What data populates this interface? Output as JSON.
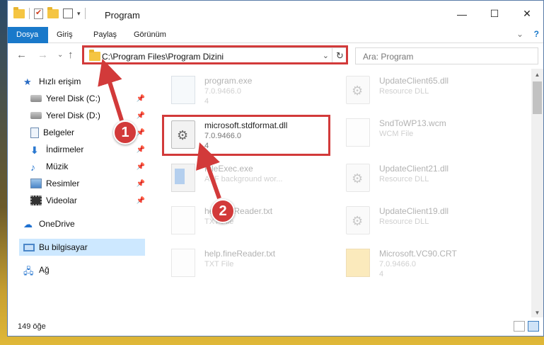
{
  "window": {
    "title": "Program",
    "controls": {
      "minimize": "—",
      "maximize": "☐",
      "close": "✕"
    }
  },
  "ribbon": {
    "tabs": [
      "Dosya",
      "Giriş",
      "Paylaş",
      "Görünüm"
    ],
    "active_tab": "Dosya",
    "expand": "⌄",
    "help": "?"
  },
  "address": {
    "back": "←",
    "forward": "→",
    "recent": "⌄",
    "up": "↑",
    "path": "C:\\Program Files\\Program Dizini",
    "dropdown": "⌄",
    "refresh": "↻"
  },
  "search": {
    "placeholder": "Ara: Program"
  },
  "sidebar": {
    "items": [
      {
        "label": "Hızlı erişim",
        "icon": "star-icon",
        "pinned": false
      },
      {
        "label": "Yerel Disk (C:)",
        "icon": "disk-icon",
        "pinned": true
      },
      {
        "label": "Yerel Disk (D:)",
        "icon": "disk-icon",
        "pinned": true
      },
      {
        "label": "Belgeler",
        "icon": "documents-icon",
        "pinned": true
      },
      {
        "label": "İndirmeler",
        "icon": "downloads-icon",
        "pinned": true
      },
      {
        "label": "Müzik",
        "icon": "music-icon",
        "pinned": true
      },
      {
        "label": "Resimler",
        "icon": "pictures-icon",
        "pinned": true
      },
      {
        "label": "Videolar",
        "icon": "videos-icon",
        "pinned": true
      },
      {
        "label": "OneDrive",
        "icon": "cloud-icon",
        "pinned": false
      },
      {
        "label": "Bu bilgisayar",
        "icon": "computer-icon",
        "pinned": false
      },
      {
        "label": "Ağ",
        "icon": "network-icon",
        "pinned": false
      }
    ],
    "pin_glyph": "📌"
  },
  "files": {
    "left": [
      {
        "name": "program.exe",
        "line2": "7.0.9466.0",
        "line3": "4"
      },
      {
        "name": "microsoft.stdformat.dll",
        "line2": "7.0.9466.0",
        "line3": "4"
      },
      {
        "name": "FileExec.exe",
        "line2": "AVF background wor...",
        "line3": ""
      },
      {
        "name": "help.fileReader.txt",
        "line2": "TXT File",
        "line3": ""
      },
      {
        "name": "help.fineReader.txt",
        "line2": "TXT File",
        "line3": ""
      }
    ],
    "right": [
      {
        "name": "UpdateClient65.dll",
        "line2": "Resource DLL",
        "line3": ""
      },
      {
        "name": "SndToWP13.wcm",
        "line2": "WCM File",
        "line3": ""
      },
      {
        "name": "UpdateClient21.dll",
        "line2": "Resource DLL",
        "line3": ""
      },
      {
        "name": "UpdateClient19.dll",
        "line2": "Resource DLL",
        "line3": ""
      },
      {
        "name": "Microsoft.VC90.CRT",
        "line2": "7.0.9466.0",
        "line3": "4"
      }
    ]
  },
  "status": {
    "item_count": "149 öğe"
  },
  "callouts": [
    "1",
    "2"
  ],
  "colors": {
    "accent": "#1979ca",
    "callout": "#d23a3a",
    "selection": "#cde8ff"
  }
}
